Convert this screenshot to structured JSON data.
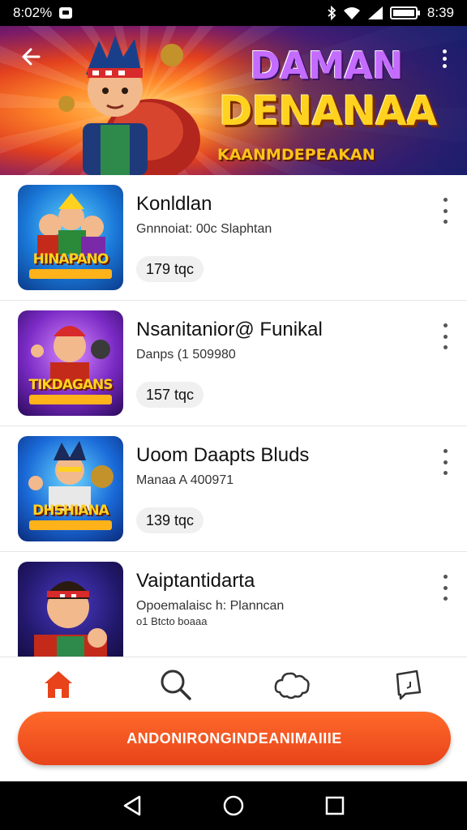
{
  "status_bar": {
    "time_left": "8:02%",
    "time_right": "8:39",
    "icons": [
      "notification-icon",
      "bluetooth-icon",
      "wifi-icon",
      "signal-icon",
      "battery-icon"
    ]
  },
  "hero": {
    "title_line1": "DAMAN",
    "title_line2": "DENANAA",
    "subtitle": "KAANMDEPEAKAN",
    "back_icon": "back-arrow-icon",
    "more_icon": "more-vertical-icon"
  },
  "games": [
    {
      "title": "Konldlan",
      "meta": "Gnnnoiat: 00c Slaphtan",
      "meta2": "",
      "pill": "179 tqc",
      "thumb_label": "HINAPANO",
      "colors": [
        "#0b5cc4",
        "#1ab6f0",
        "#ffd21f"
      ]
    },
    {
      "title": "Nsanitanior@ Funikal",
      "meta": "Danps (1 509980",
      "meta2": "",
      "pill": "157 tqc",
      "thumb_label": "TIKDAGANS",
      "colors": [
        "#3a1a7a",
        "#a43ad8",
        "#ffd21f"
      ]
    },
    {
      "title": "Uoom Daapts Bluds",
      "meta": "Manaa A 400971",
      "meta2": "",
      "pill": "139 tqc",
      "thumb_label": "DHSHIANA",
      "colors": [
        "#0d3a8a",
        "#25a6e6",
        "#ffd21f"
      ]
    },
    {
      "title": "Vaiptantidarta",
      "meta": "Opoemalaisc h: Planncan",
      "meta2": "o1 Btcto boaaa",
      "pill": "",
      "thumb_label": "",
      "colors": [
        "#1a1a6a",
        "#3a2aa8",
        "#c42a1a"
      ]
    }
  ],
  "bottom_nav": {
    "tabs": [
      {
        "icon": "home-icon",
        "active": true
      },
      {
        "icon": "search-icon",
        "active": false
      },
      {
        "icon": "community-icon",
        "active": false
      },
      {
        "icon": "chat-icon",
        "active": false
      }
    ],
    "active_color": "#e8431a"
  },
  "cta": {
    "label": "ANDONIRONGINDEANIMAIIIE",
    "color": "#e8431a"
  },
  "system_nav": {
    "icons": [
      "back-triangle-icon",
      "home-circle-icon",
      "recents-square-icon"
    ]
  }
}
